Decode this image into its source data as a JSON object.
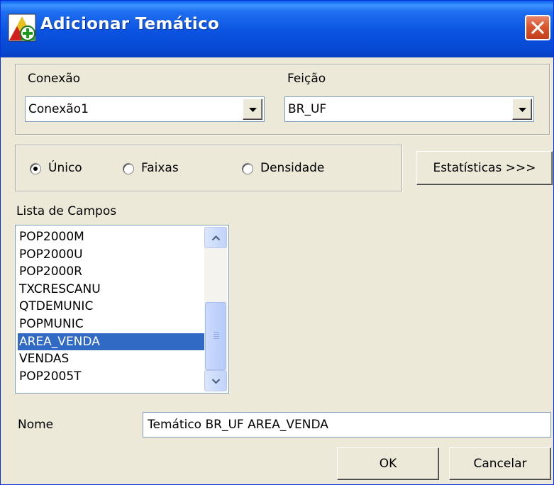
{
  "window": {
    "title": "Adicionar Temático",
    "close_icon": "close-icon",
    "app_icon": "add-theme-icon"
  },
  "connection": {
    "label": "Conexão",
    "value": "Conexão1"
  },
  "feature": {
    "label": "Feição",
    "value": "BR_UF"
  },
  "mode": {
    "options": [
      {
        "label": "Único",
        "checked": true
      },
      {
        "label": "Faixas",
        "checked": false
      },
      {
        "label": "Densidade",
        "checked": false
      }
    ]
  },
  "statistics_button": "Estatísticas >>>",
  "fields": {
    "label": "Lista de Campos",
    "items": [
      "POP2000M",
      "POP2000U",
      "POP2000R",
      "TXCRESCANU",
      "QTDEMUNIC",
      "POPMUNIC",
      "AREA_VENDA",
      "VENDAS",
      "POP2005T"
    ],
    "selected": "AREA_VENDA"
  },
  "name": {
    "label": "Nome",
    "value": "Temático BR_UF AREA_VENDA"
  },
  "buttons": {
    "ok": "OK",
    "cancel": "Cancelar"
  },
  "colors": {
    "title_bar": "#0a53e0",
    "selection": "#316ac5",
    "close_button": "#d9562f"
  }
}
